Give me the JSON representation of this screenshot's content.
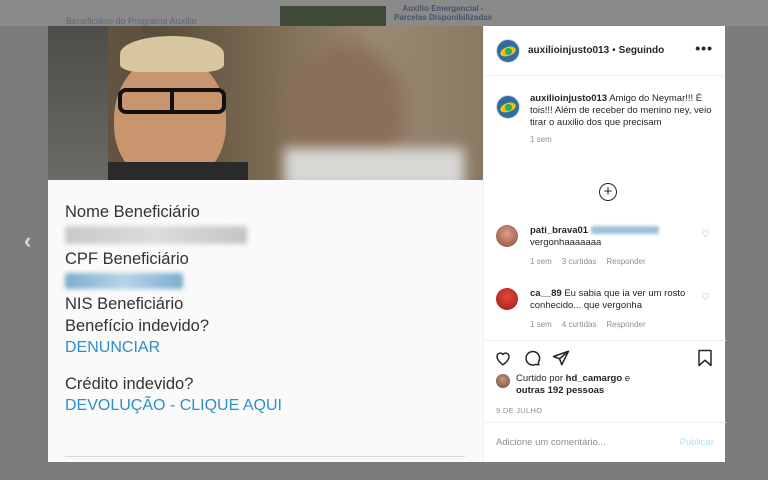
{
  "background": {
    "link_text": "Beneficiário do Programa Auxílio",
    "banner_text": "Auxílio Emergencial - Parcelas Disponibilizadas"
  },
  "nav": {
    "prev_icon": "‹"
  },
  "media": {
    "labels": {
      "name": "Nome Beneficiário",
      "cpf": "CPF Beneficiário",
      "nis": "NIS Beneficiário",
      "benefit": "Benefício indevido?",
      "credit": "Crédito indevido?"
    },
    "links": {
      "report": "DENUNCIAR",
      "refund": "DEVOLUÇÃO - CLIQUE AQUI"
    }
  },
  "post": {
    "username": "auxilioinjusto013",
    "follow_status": "Seguindo",
    "more_icon": "•••",
    "caption": {
      "username": "auxilioinjusto013",
      "text": "Amigo do Neymar!!! É tois!!! Além de receber do menino ney, veio tirar o auxilio dos que precisam",
      "time": "1 sem"
    },
    "load_more_icon": "+",
    "comments": [
      {
        "username": "pati_brava01",
        "text": "vergonhaaaaaaa",
        "time": "1 sem",
        "likes": "3 curtidas",
        "reply": "Responder"
      },
      {
        "username": "ca__89",
        "text": "Eu sabia que ia ver um rosto conhecido... que vergonha",
        "time": "1 sem",
        "likes": "4 curtidas",
        "reply": "Responder"
      }
    ],
    "liked_by": {
      "prefix": "Curtido por",
      "user": "hd_camargo",
      "middle": "e",
      "others": "outras 192 pessoas"
    },
    "date": "9 DE JULHO",
    "comment_placeholder": "Adicione um comentário...",
    "publish_label": "Publicar"
  }
}
